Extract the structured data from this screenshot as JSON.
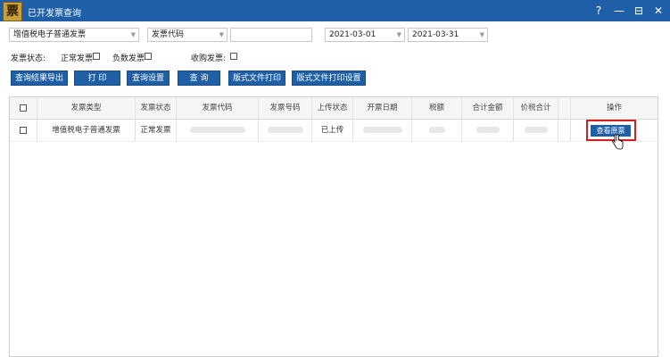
{
  "window": {
    "title": "已开发票查询",
    "icon_glyph": "票",
    "controls": {
      "help": "?",
      "minimize": "—",
      "restore": "⊟",
      "close": "✕"
    }
  },
  "filters": {
    "invoice_type": "增值税电子普通发票",
    "code_field": "发票代码",
    "code_value": "",
    "date_from": "2021-03-01",
    "date_to": "2021-03-31"
  },
  "status_filters": {
    "label": "发票状态:",
    "normal": "正常发票",
    "negative": "负数发票",
    "collected_label": "收购发票:"
  },
  "buttons": {
    "export": "查询结果导出",
    "print": "打 印",
    "query_settings": "查询设置",
    "query": "查 询",
    "layout_print": "版式文件打印",
    "layout_print_settings": "版式文件打印设置"
  },
  "table": {
    "headers": [
      "发票类型",
      "发票状态",
      "发票代码",
      "发票号码",
      "上传状态",
      "开票日期",
      "税额",
      "合计金额",
      "价税合计",
      "操作"
    ],
    "rows": [
      {
        "type": "增值税电子普通发票",
        "status": "正常发票",
        "upload": "已上传",
        "action": "查看原票"
      }
    ]
  },
  "colors": {
    "accent": "#1f5fa6",
    "titlebar": "#1e5fa8",
    "highlight": "#d62020"
  }
}
